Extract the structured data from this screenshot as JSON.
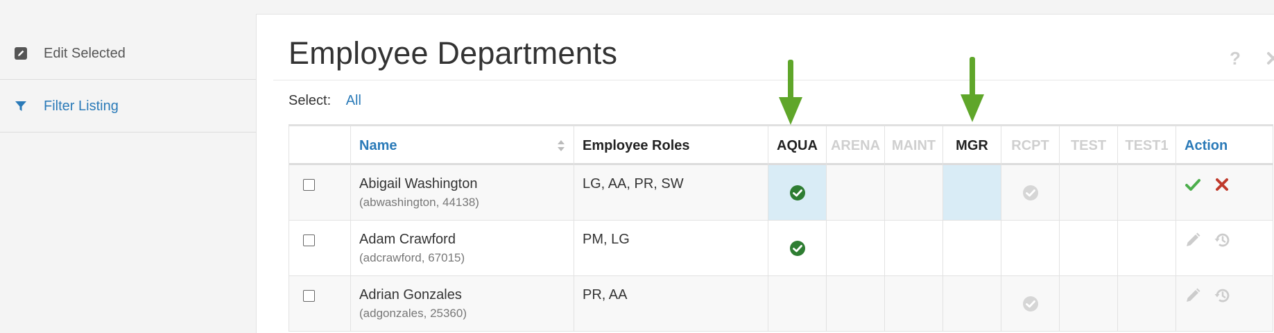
{
  "sidebar": {
    "items": [
      {
        "label": "Edit Selected",
        "icon": "edit-icon"
      },
      {
        "label": "Filter Listing",
        "icon": "filter-icon"
      }
    ]
  },
  "page": {
    "title": "Employee Departments",
    "select_label": "Select:",
    "select_all": "All"
  },
  "colors": {
    "link": "#2a7ab8",
    "check_green": "#2e7d32",
    "arrow_green": "#5fa62a",
    "reject_red": "#c0392b",
    "highlight": "#d9ecf6"
  },
  "table": {
    "headers": {
      "name": "Name",
      "roles": "Employee Roles",
      "action": "Action"
    },
    "departments": [
      {
        "code": "AQUA",
        "active": true
      },
      {
        "code": "ARENA",
        "active": false
      },
      {
        "code": "MAINT",
        "active": false
      },
      {
        "code": "MGR",
        "active": true
      },
      {
        "code": "RCPT",
        "active": false
      },
      {
        "code": "TEST",
        "active": false
      },
      {
        "code": "TEST1",
        "active": false
      }
    ],
    "rows": [
      {
        "name": "Abigail Washington",
        "sub": "(abwashington, 44138)",
        "roles": "LG, AA, PR, SW",
        "aqua": "check-green",
        "rcpt": "check-grey",
        "actions": [
          "accept-check-icon",
          "reject-x-icon"
        ]
      },
      {
        "name": "Adam Crawford",
        "sub": "(adcrawford, 67015)",
        "roles": "PM, LG",
        "aqua": "check-green",
        "rcpt": "",
        "actions": [
          "pencil-icon",
          "history-icon"
        ]
      },
      {
        "name": "Adrian Gonzales",
        "sub": "(adgonzales, 25360)",
        "roles": "PR, AA",
        "aqua": "",
        "rcpt": "check-grey",
        "actions": [
          "pencil-icon",
          "history-icon"
        ]
      }
    ]
  }
}
